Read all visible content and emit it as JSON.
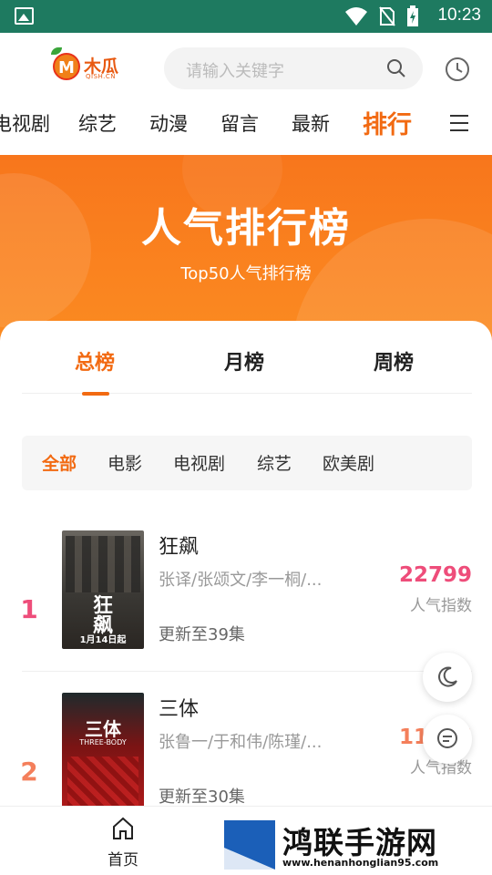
{
  "status_bar": {
    "time": "10:23"
  },
  "header": {
    "logo_name": "木瓜",
    "logo_sub": "QISH.CN",
    "logo_letter": "M",
    "search_placeholder": "请输入关键字"
  },
  "nav": {
    "items": [
      {
        "label": "电视剧"
      },
      {
        "label": "综艺"
      },
      {
        "label": "动漫"
      },
      {
        "label": "留言"
      },
      {
        "label": "最新"
      },
      {
        "label": "排行"
      }
    ],
    "active": "排行"
  },
  "hero": {
    "title": "人气排行榜",
    "subtitle": "Top50人气排行榜"
  },
  "tabs": [
    {
      "label": "总榜"
    },
    {
      "label": "月榜"
    },
    {
      "label": "周榜"
    }
  ],
  "filters": [
    {
      "label": "全部"
    },
    {
      "label": "电影"
    },
    {
      "label": "电视剧"
    },
    {
      "label": "综艺"
    },
    {
      "label": "欧美剧"
    }
  ],
  "ranking": [
    {
      "rank": "1",
      "title": "狂飙",
      "cast": "张译/张颂文/李一桐/...",
      "update": "更新至39集",
      "score": "22799",
      "score_label": "人气指数",
      "poster_text": "1月14日起",
      "poster_big": "狂飙",
      "rank_color": "#ee4d7a",
      "score_color": "#ee4d7a"
    },
    {
      "rank": "2",
      "title": "三体",
      "cast": "张鲁一/于和伟/陈瑾/...",
      "update": "更新至30集",
      "score": "11076",
      "score_label": "人气指数",
      "poster_text": "THREE-BODY",
      "poster_big": "三体",
      "rank_color": "#f47f5b",
      "score_color": "#f47f5b"
    }
  ],
  "bottom_nav": {
    "home_label": "首页"
  },
  "watermark": {
    "text": "鸿联手游网",
    "url": "www.henanhonglian95.com"
  },
  "colors": {
    "accent": "#f26a12",
    "status_bar": "#1e7a60",
    "hero": "#fb8b21"
  }
}
